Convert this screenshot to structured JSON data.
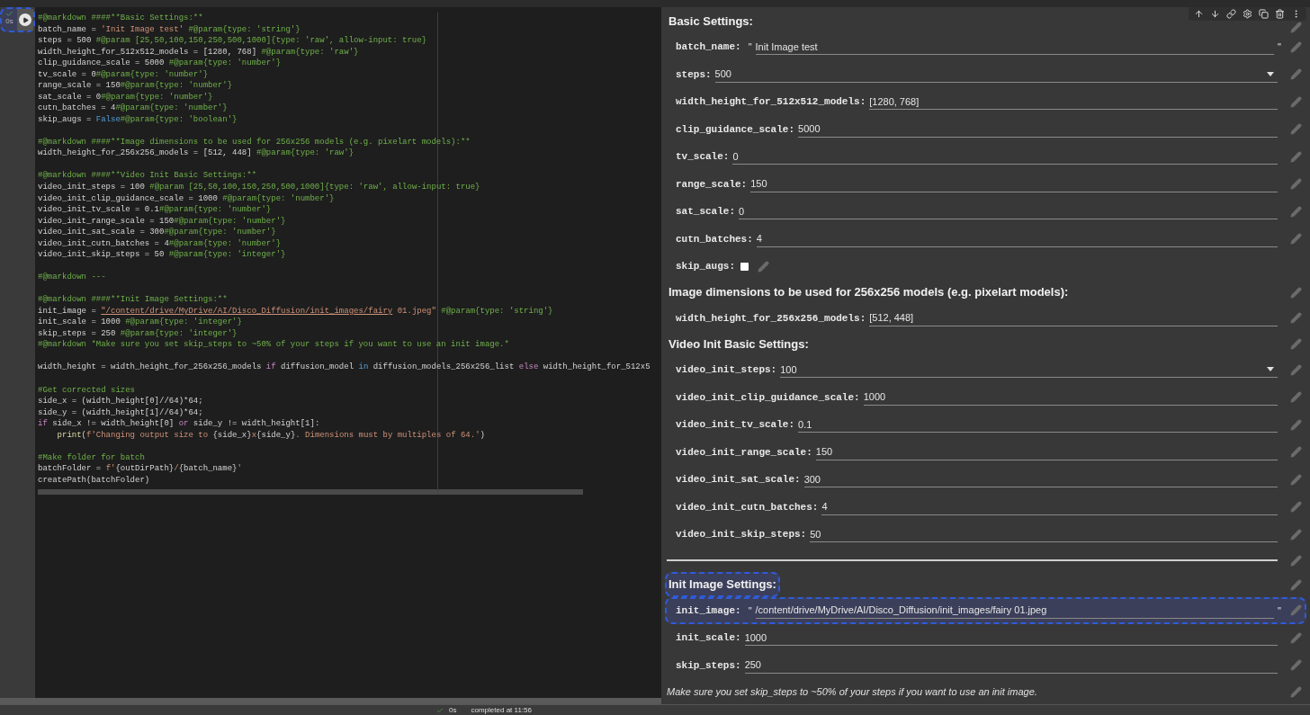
{
  "cell": {
    "run_button": {
      "highlighted": true
    },
    "exec_time": "0s"
  },
  "code": {
    "blocks": [
      {
        "lines": [
          {
            "segments": [
              {
                "kind": "comment",
                "text": "#@markdown ####**Basic Settings:**"
              }
            ]
          },
          {
            "segments": [
              {
                "kind": "plain",
                "text": "batch_name = "
              },
              {
                "kind": "string",
                "text": "'Init Image test'"
              },
              {
                "kind": "comment",
                "text": " #@param{type: 'string'}"
              }
            ]
          },
          {
            "segments": [
              {
                "kind": "plain",
                "text": "steps = 500 "
              },
              {
                "kind": "comment",
                "text": "#@param [25,50,100,150,250,500,1000]{type: 'raw', allow-input: true}"
              }
            ]
          },
          {
            "segments": [
              {
                "kind": "plain",
                "text": "width_height_for_512x512_models = [1280, 768] "
              },
              {
                "kind": "comment",
                "text": "#@param{type: 'raw'}"
              }
            ]
          },
          {
            "segments": [
              {
                "kind": "plain",
                "text": "clip_guidance_scale = 5000 "
              },
              {
                "kind": "comment",
                "text": "#@param{type: 'number'}"
              }
            ]
          },
          {
            "segments": [
              {
                "kind": "plain",
                "text": "tv_scale = 0"
              },
              {
                "kind": "comment",
                "text": "#@param{type: 'number'}"
              }
            ]
          },
          {
            "segments": [
              {
                "kind": "plain",
                "text": "range_scale = 150"
              },
              {
                "kind": "comment",
                "text": "#@param{type: 'number'}"
              }
            ]
          },
          {
            "segments": [
              {
                "kind": "plain",
                "text": "sat_scale = 0"
              },
              {
                "kind": "comment",
                "text": "#@param{type: 'number'}"
              }
            ]
          },
          {
            "segments": [
              {
                "kind": "plain",
                "text": "cutn_batches = 4"
              },
              {
                "kind": "comment",
                "text": "#@param{type: 'number'}"
              }
            ]
          },
          {
            "segments": [
              {
                "kind": "plain",
                "text": "skip_augs = "
              },
              {
                "kind": "constant",
                "text": "False"
              },
              {
                "kind": "comment",
                "text": "#@param{type: 'boolean'}"
              }
            ]
          }
        ]
      },
      {
        "lines": [
          {
            "segments": [
              {
                "kind": "comment",
                "text": "#@markdown ####**Image dimensions to be used for 256x256 models (e.g. pixelart models):**"
              }
            ]
          },
          {
            "segments": [
              {
                "kind": "plain",
                "text": "width_height_for_256x256_models = [512, 448] "
              },
              {
                "kind": "comment",
                "text": "#@param{type: 'raw'}"
              }
            ]
          }
        ]
      },
      {
        "lines": [
          {
            "segments": [
              {
                "kind": "comment",
                "text": "#@markdown ####**Video Init Basic Settings:**"
              }
            ]
          },
          {
            "segments": [
              {
                "kind": "plain",
                "text": "video_init_steps = 100 "
              },
              {
                "kind": "comment",
                "text": "#@param [25,50,100,150,250,500,1000]{type: 'raw', allow-input: true}"
              }
            ]
          },
          {
            "segments": [
              {
                "kind": "plain",
                "text": "video_init_clip_guidance_scale = 1000 "
              },
              {
                "kind": "comment",
                "text": "#@param{type: 'number'}"
              }
            ]
          },
          {
            "segments": [
              {
                "kind": "plain",
                "text": "video_init_tv_scale = 0.1"
              },
              {
                "kind": "comment",
                "text": "#@param{type: 'number'}"
              }
            ]
          },
          {
            "segments": [
              {
                "kind": "plain",
                "text": "video_init_range_scale = 150"
              },
              {
                "kind": "comment",
                "text": "#@param{type: 'number'}"
              }
            ]
          },
          {
            "segments": [
              {
                "kind": "plain",
                "text": "video_init_sat_scale = 300"
              },
              {
                "kind": "comment",
                "text": "#@param{type: 'number'}"
              }
            ]
          },
          {
            "segments": [
              {
                "kind": "plain",
                "text": "video_init_cutn_batches = 4"
              },
              {
                "kind": "comment",
                "text": "#@param{type: 'number'}"
              }
            ]
          },
          {
            "segments": [
              {
                "kind": "plain",
                "text": "video_init_skip_steps = 50 "
              },
              {
                "kind": "comment",
                "text": "#@param{type: 'integer'}"
              }
            ]
          }
        ]
      },
      {
        "lines": [
          {
            "segments": [
              {
                "kind": "comment",
                "text": "#@markdown ---"
              }
            ]
          }
        ]
      },
      {
        "lines": [
          {
            "segments": [
              {
                "kind": "comment",
                "text": "#@markdown ####**Init Image Settings:**"
              }
            ]
          },
          {
            "segments": [
              {
                "kind": "plain",
                "text": "init_image = "
              },
              {
                "kind": "link",
                "text": "\"/content/drive/MyDrive/AI/Disco_Diffusion/init_images/fairy"
              },
              {
                "kind": "string",
                "text": " 01.jpeg\""
              },
              {
                "kind": "comment",
                "text": " #@param{type: 'string'}"
              }
            ]
          },
          {
            "segments": [
              {
                "kind": "plain",
                "text": "init_scale = 1000 "
              },
              {
                "kind": "comment",
                "text": "#@param{type: 'integer'}"
              }
            ]
          },
          {
            "segments": [
              {
                "kind": "plain",
                "text": "skip_steps = 250 "
              },
              {
                "kind": "comment",
                "text": "#@param{type: 'integer'}"
              }
            ]
          },
          {
            "segments": [
              {
                "kind": "comment",
                "text": "#@markdown *Make sure you set skip_steps to ~50% of your steps if you want to use an init image.*"
              }
            ]
          }
        ]
      },
      {
        "lines": [
          {
            "segments": [
              {
                "kind": "plain",
                "text": "width_height = width_height_for_256x256_models "
              },
              {
                "kind": "keyword",
                "text": "if"
              },
              {
                "kind": "plain",
                "text": " diffusion_model "
              },
              {
                "kind": "constant",
                "text": "in"
              },
              {
                "kind": "plain",
                "text": " diffusion_models_256x256_list "
              },
              {
                "kind": "keyword",
                "text": "else"
              },
              {
                "kind": "plain",
                "text": " width_height_for_512x5"
              }
            ]
          }
        ]
      },
      {
        "lines": [
          {
            "segments": [
              {
                "kind": "comment",
                "text": "#Get corrected sizes"
              }
            ]
          },
          {
            "segments": [
              {
                "kind": "plain",
                "text": "side_x = (width_height[0]//64)*64;"
              }
            ]
          },
          {
            "segments": [
              {
                "kind": "plain",
                "text": "side_y = (width_height[1]//64)*64;"
              }
            ]
          },
          {
            "segments": [
              {
                "kind": "keyword",
                "text": "if"
              },
              {
                "kind": "plain",
                "text": " side_x != width_height[0] "
              },
              {
                "kind": "keyword",
                "text": "or"
              },
              {
                "kind": "plain",
                "text": " side_y != width_height[1]:"
              }
            ],
            "children": [
              {
                "segments": [
                  {
                    "kind": "function",
                    "text": "print"
                  },
                  {
                    "kind": "plain",
                    "text": "("
                  },
                  {
                    "kind": "string",
                    "text": "f'Changing output size to "
                  },
                  {
                    "kind": "plain",
                    "text": "{side_x}"
                  },
                  {
                    "kind": "string",
                    "text": "x"
                  },
                  {
                    "kind": "plain",
                    "text": "{side_y}"
                  },
                  {
                    "kind": "string",
                    "text": ". Dimensions must by multiples of 64.'"
                  },
                  {
                    "kind": "plain",
                    "text": ")"
                  }
                ]
              }
            ]
          }
        ]
      },
      {
        "lines": [
          {
            "segments": [
              {
                "kind": "comment",
                "text": "#Make folder for batch"
              }
            ]
          },
          {
            "segments": [
              {
                "kind": "plain",
                "text": "batchFolder = "
              },
              {
                "kind": "string",
                "text": "f'"
              },
              {
                "kind": "plain",
                "text": "{outDirPath}"
              },
              {
                "kind": "string",
                "text": "/"
              },
              {
                "kind": "plain",
                "text": "{batch_name}"
              },
              {
                "kind": "string",
                "text": "'"
              }
            ]
          },
          {
            "segments": [
              {
                "kind": "plain",
                "text": "createPath(batchFolder)"
              }
            ]
          }
        ]
      }
    ]
  },
  "form": {
    "items": [
      {
        "kind": "heading",
        "text": "Basic Settings:",
        "highlighted": false
      },
      {
        "kind": "text",
        "label": "batch_name:",
        "open_quote": "\"",
        "value": "Init Image test",
        "close_quote": "\"",
        "highlighted": false
      },
      {
        "kind": "dropdown",
        "label": "steps:",
        "value": "500",
        "highlighted": false
      },
      {
        "kind": "field",
        "label": "width_height_for_512x512_models:",
        "value": "[1280, 768]",
        "highlighted": false
      },
      {
        "kind": "field",
        "label": "clip_guidance_scale:",
        "value": "5000",
        "highlighted": false
      },
      {
        "kind": "field",
        "label": "tv_scale:",
        "value": "0",
        "highlighted": false
      },
      {
        "kind": "field",
        "label": "range_scale:",
        "value": "150",
        "highlighted": false
      },
      {
        "kind": "field",
        "label": "sat_scale:",
        "value": "0",
        "highlighted": false
      },
      {
        "kind": "field",
        "label": "cutn_batches:",
        "value": "4",
        "highlighted": false
      },
      {
        "kind": "checkbox",
        "label": "skip_augs:",
        "checked": false,
        "highlighted": false
      },
      {
        "kind": "heading",
        "text": "Image dimensions to be used for 256x256 models (e.g. pixelart models):",
        "highlighted": false
      },
      {
        "kind": "field",
        "label": "width_height_for_256x256_models:",
        "value": "[512, 448]",
        "highlighted": false
      },
      {
        "kind": "heading",
        "text": "Video Init Basic Settings:",
        "highlighted": false
      },
      {
        "kind": "dropdown",
        "label": "video_init_steps:",
        "value": "100",
        "highlighted": false
      },
      {
        "kind": "field",
        "label": "video_init_clip_guidance_scale:",
        "value": "1000",
        "highlighted": false
      },
      {
        "kind": "field",
        "label": "video_init_tv_scale:",
        "value": "0.1",
        "highlighted": false
      },
      {
        "kind": "field",
        "label": "video_init_range_scale:",
        "value": "150",
        "highlighted": false
      },
      {
        "kind": "field",
        "label": "video_init_sat_scale:",
        "value": "300",
        "highlighted": false
      },
      {
        "kind": "field",
        "label": "video_init_cutn_batches:",
        "value": "4",
        "highlighted": false
      },
      {
        "kind": "field",
        "label": "video_init_skip_steps:",
        "value": "50",
        "highlighted": false
      },
      {
        "kind": "rule"
      },
      {
        "kind": "heading",
        "text": "Init Image Settings:",
        "highlighted": true
      },
      {
        "kind": "text",
        "label": "init_image:",
        "open_quote": "\"",
        "value": "/content/drive/MyDrive/AI/Disco_Diffusion/init_images/fairy 01.jpeg",
        "close_quote": "\"",
        "highlighted": true
      },
      {
        "kind": "field",
        "label": "init_scale:",
        "value": "1000",
        "highlighted": false
      },
      {
        "kind": "field",
        "label": "skip_steps:",
        "value": "250",
        "highlighted": false
      },
      {
        "kind": "note",
        "text": "Make sure you set skip_steps to ~50% of your steps if you want to use an init image."
      }
    ]
  },
  "status_bar": {
    "time": "0s",
    "text": "completed at 11:56"
  }
}
